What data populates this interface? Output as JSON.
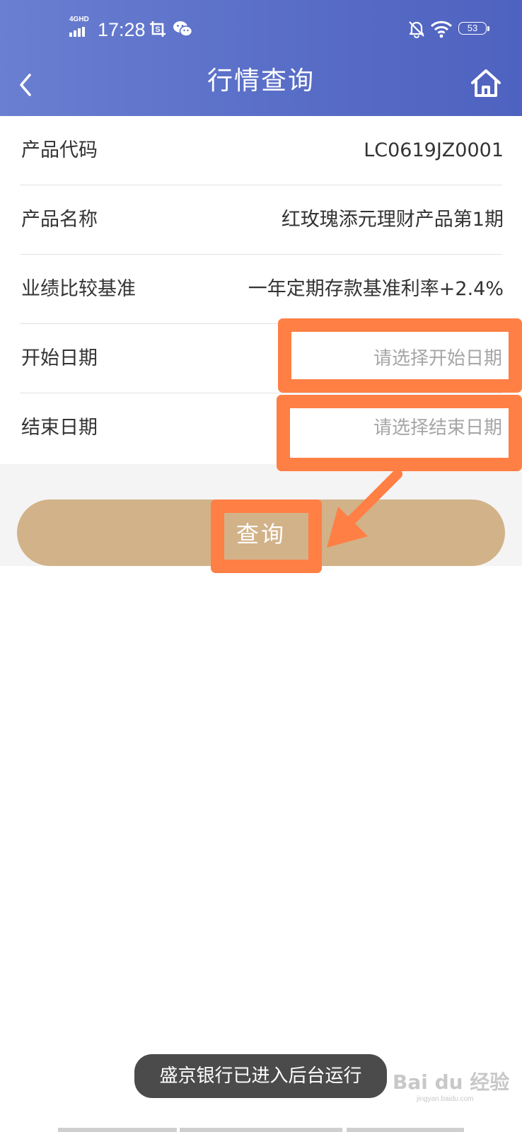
{
  "status_bar": {
    "network": "4GHD",
    "time": "17:28",
    "battery": "53",
    "icons": [
      "signal-icon",
      "screenshot-icon",
      "wechat-icon",
      "mute-bell-icon",
      "wifi-icon",
      "battery-icon"
    ]
  },
  "nav": {
    "title": "行情查询",
    "back_icon": "chevron-left-icon",
    "home_icon": "home-icon"
  },
  "form": {
    "product_code": {
      "label": "产品代码",
      "value": "LC0619JZ0001"
    },
    "product_name": {
      "label": "产品名称",
      "value": "红玫瑰添元理财产品第1期"
    },
    "benchmark": {
      "label": "业绩比较基准",
      "value": "一年定期存款基准利率+2.4%"
    },
    "start_date": {
      "label": "开始日期",
      "placeholder": "请选择开始日期"
    },
    "end_date": {
      "label": "结束日期",
      "placeholder": "请选择结束日期"
    }
  },
  "query_button": {
    "label": "查询"
  },
  "toast": "盛京银行已进入后台运行",
  "watermark": {
    "main": "Bai du 经验",
    "sub": "jingyan.baidu.com"
  },
  "colors": {
    "header_gradient": [
      "#6a7fd0",
      "#4e62bf"
    ],
    "button": "#d2b289",
    "highlight": "#ff7f45",
    "toast_bg": "#4b4b4b"
  }
}
